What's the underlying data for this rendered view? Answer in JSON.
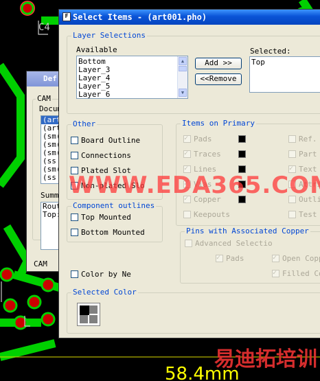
{
  "colors": {
    "accent": "#0046d5",
    "pcb_trace": "#00d000",
    "pcb_pad": "#cc0000",
    "dimension": "#ffff00"
  },
  "pcb": {
    "label_c4": "C4",
    "dimension_text": "58.4mm"
  },
  "watermark": {
    "site": "WWW.EDA365.COM",
    "chinese": "易迪拓培训"
  },
  "back_window": {
    "title": "Def",
    "group_label": "CAM",
    "doc_label": "Docum",
    "doc_items": [
      "(art",
      "(art",
      "(sm(",
      "(sm(",
      "(sm(",
      "(ss",
      "(sm(",
      "(ss"
    ],
    "summary_label": "Summ",
    "summary_items": [
      "Rout",
      "Top:"
    ],
    "bottom_tab": "CAM"
  },
  "dialog": {
    "title": "Select Items - (art001.pho)",
    "title_icon": "app-icon",
    "layer_selections": {
      "label": "Layer Selections",
      "available_label": "Available",
      "available_items": [
        "Bottom",
        "Layer_3",
        "Layer_4",
        "Layer_5",
        "Layer_6"
      ],
      "add_button": "Add >>",
      "remove_button": "<<Remove",
      "selected_label": "Selected:",
      "selected_items": [
        "Top"
      ]
    },
    "other": {
      "label": "Other",
      "items": [
        "Board Outline",
        "Connections",
        "Plated Slot",
        "Non-plated Slo"
      ]
    },
    "component_outlines": {
      "label": "Component outlines",
      "items": [
        "Top Mounted",
        "Bottom Mounted"
      ]
    },
    "color_by_net": "Color by Ne",
    "items_on_primary": {
      "label": "Items on Primary",
      "left_items": [
        "Pads",
        "Traces",
        "Lines",
        "Vias",
        "Copper",
        "Keepouts"
      ],
      "right_items": [
        "Ref.",
        "Part",
        "Text",
        "Attri",
        "Outli",
        "Test"
      ]
    },
    "pins_copper": {
      "label": "Pins with Associated Copper",
      "advanced": "Advanced Selectio",
      "items": [
        "Pads",
        "Open Copp",
        "Filled Co"
      ]
    },
    "selected_color": {
      "label": "Selected Color"
    }
  }
}
